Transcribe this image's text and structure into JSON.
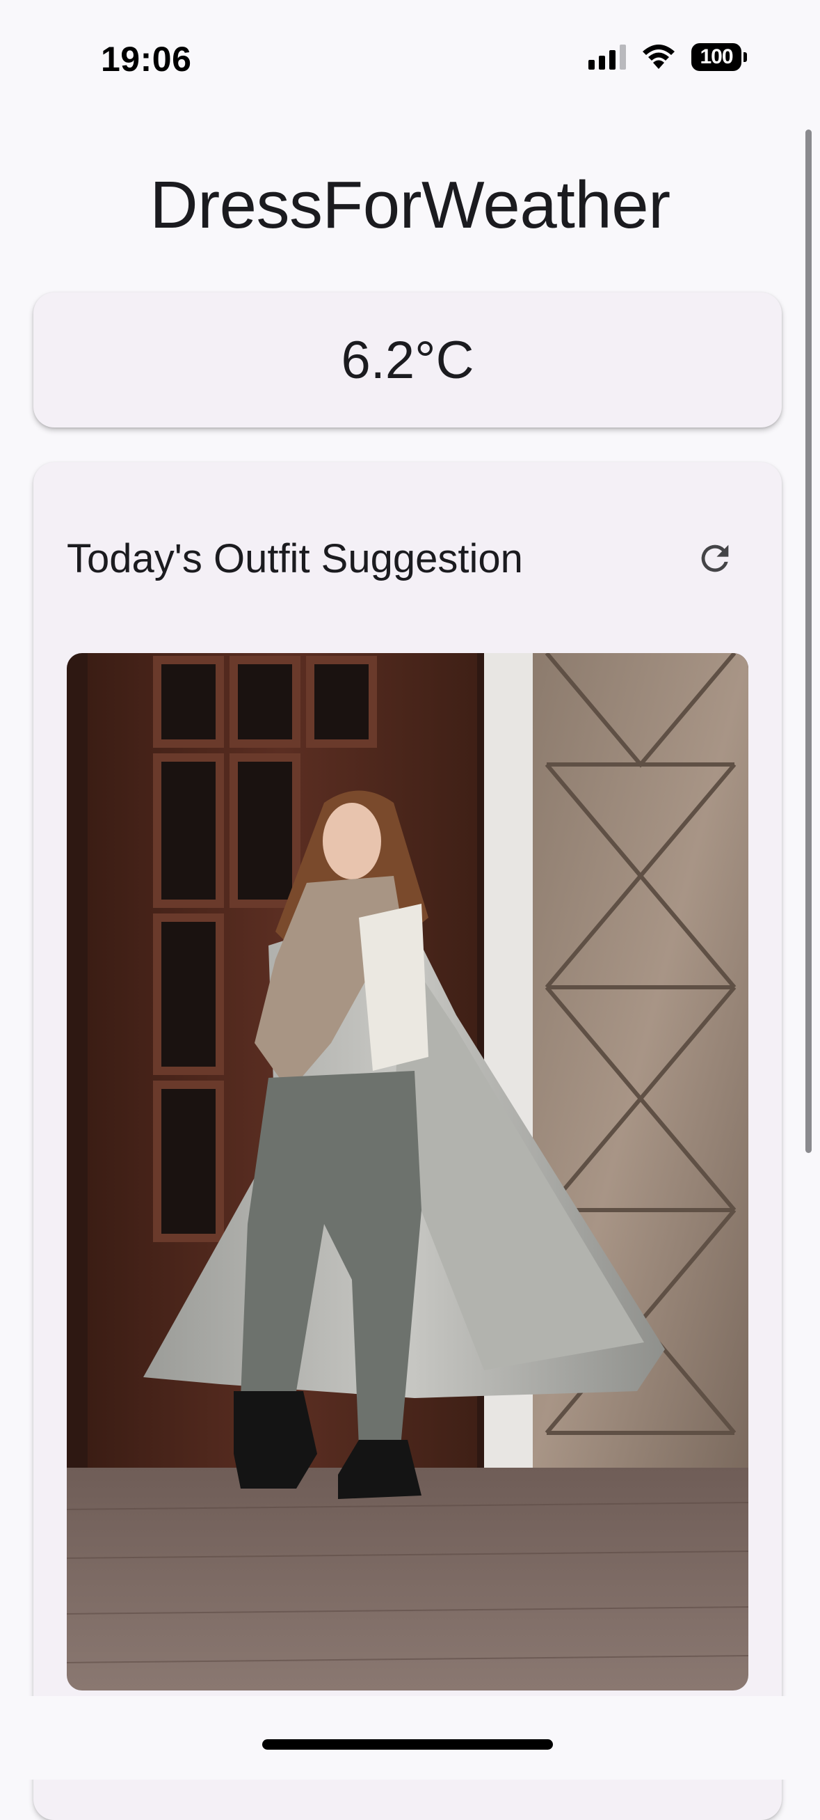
{
  "status_bar": {
    "time": "19:06",
    "battery": "100",
    "icons": [
      "cellular-signal-icon",
      "wifi-icon",
      "battery-icon"
    ]
  },
  "app": {
    "title": "DressForWeather"
  },
  "weather": {
    "temperature": "6.2°C"
  },
  "outfit": {
    "heading": "Today's Outfit Suggestion",
    "refresh_icon": "refresh-icon",
    "image_description_icon": "outfit-photo"
  },
  "colors": {
    "background": "#f9f8fb",
    "card": "#f4f0f6",
    "text": "#1b1b1f"
  }
}
